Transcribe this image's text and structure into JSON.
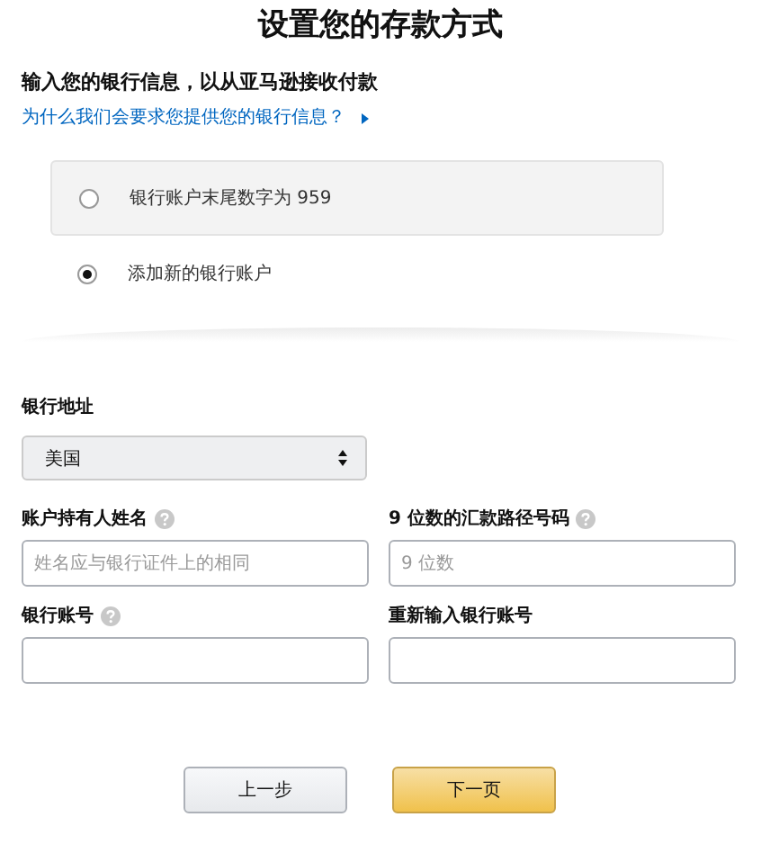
{
  "title": "设置您的存款方式",
  "subtitle": "输入您的银行信息，以从亚马逊接收付款",
  "help_link": "为什么我们会要求您提供您的银行信息？",
  "options": [
    {
      "label": "银行账户末尾数字为 959",
      "selected": false
    },
    {
      "label": "添加新的银行账户",
      "selected": true
    }
  ],
  "bank_location": {
    "label": "银行地址",
    "value": "美国"
  },
  "fields": [
    {
      "label": "账户持有人姓名",
      "help_icon": true,
      "placeholder": "姓名应与银行证件上的相同"
    },
    {
      "label": "9 位数的汇款路径号码",
      "help_icon": true,
      "placeholder": "9 位数"
    },
    {
      "label": "银行账号",
      "help_icon": true
    },
    {
      "label": "重新输入银行账号",
      "help_icon": false
    }
  ],
  "buttons": [
    {
      "label": "上一步",
      "kind": "secondary"
    },
    {
      "label": "下一页",
      "kind": "primary"
    }
  ]
}
